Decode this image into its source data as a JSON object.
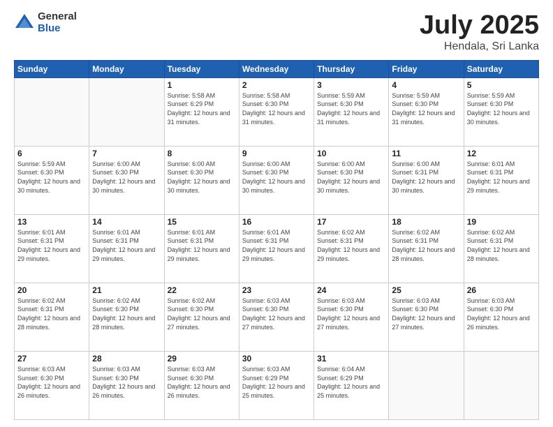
{
  "logo": {
    "general": "General",
    "blue": "Blue"
  },
  "title": {
    "month": "July 2025",
    "location": "Hendala, Sri Lanka"
  },
  "weekdays": [
    "Sunday",
    "Monday",
    "Tuesday",
    "Wednesday",
    "Thursday",
    "Friday",
    "Saturday"
  ],
  "weeks": [
    [
      {
        "day": "",
        "sunrise": "",
        "sunset": "",
        "daylight": ""
      },
      {
        "day": "",
        "sunrise": "",
        "sunset": "",
        "daylight": ""
      },
      {
        "day": "1",
        "sunrise": "Sunrise: 5:58 AM",
        "sunset": "Sunset: 6:29 PM",
        "daylight": "Daylight: 12 hours and 31 minutes."
      },
      {
        "day": "2",
        "sunrise": "Sunrise: 5:58 AM",
        "sunset": "Sunset: 6:30 PM",
        "daylight": "Daylight: 12 hours and 31 minutes."
      },
      {
        "day": "3",
        "sunrise": "Sunrise: 5:59 AM",
        "sunset": "Sunset: 6:30 PM",
        "daylight": "Daylight: 12 hours and 31 minutes."
      },
      {
        "day": "4",
        "sunrise": "Sunrise: 5:59 AM",
        "sunset": "Sunset: 6:30 PM",
        "daylight": "Daylight: 12 hours and 31 minutes."
      },
      {
        "day": "5",
        "sunrise": "Sunrise: 5:59 AM",
        "sunset": "Sunset: 6:30 PM",
        "daylight": "Daylight: 12 hours and 30 minutes."
      }
    ],
    [
      {
        "day": "6",
        "sunrise": "Sunrise: 5:59 AM",
        "sunset": "Sunset: 6:30 PM",
        "daylight": "Daylight: 12 hours and 30 minutes."
      },
      {
        "day": "7",
        "sunrise": "Sunrise: 6:00 AM",
        "sunset": "Sunset: 6:30 PM",
        "daylight": "Daylight: 12 hours and 30 minutes."
      },
      {
        "day": "8",
        "sunrise": "Sunrise: 6:00 AM",
        "sunset": "Sunset: 6:30 PM",
        "daylight": "Daylight: 12 hours and 30 minutes."
      },
      {
        "day": "9",
        "sunrise": "Sunrise: 6:00 AM",
        "sunset": "Sunset: 6:30 PM",
        "daylight": "Daylight: 12 hours and 30 minutes."
      },
      {
        "day": "10",
        "sunrise": "Sunrise: 6:00 AM",
        "sunset": "Sunset: 6:30 PM",
        "daylight": "Daylight: 12 hours and 30 minutes."
      },
      {
        "day": "11",
        "sunrise": "Sunrise: 6:00 AM",
        "sunset": "Sunset: 6:31 PM",
        "daylight": "Daylight: 12 hours and 30 minutes."
      },
      {
        "day": "12",
        "sunrise": "Sunrise: 6:01 AM",
        "sunset": "Sunset: 6:31 PM",
        "daylight": "Daylight: 12 hours and 29 minutes."
      }
    ],
    [
      {
        "day": "13",
        "sunrise": "Sunrise: 6:01 AM",
        "sunset": "Sunset: 6:31 PM",
        "daylight": "Daylight: 12 hours and 29 minutes."
      },
      {
        "day": "14",
        "sunrise": "Sunrise: 6:01 AM",
        "sunset": "Sunset: 6:31 PM",
        "daylight": "Daylight: 12 hours and 29 minutes."
      },
      {
        "day": "15",
        "sunrise": "Sunrise: 6:01 AM",
        "sunset": "Sunset: 6:31 PM",
        "daylight": "Daylight: 12 hours and 29 minutes."
      },
      {
        "day": "16",
        "sunrise": "Sunrise: 6:01 AM",
        "sunset": "Sunset: 6:31 PM",
        "daylight": "Daylight: 12 hours and 29 minutes."
      },
      {
        "day": "17",
        "sunrise": "Sunrise: 6:02 AM",
        "sunset": "Sunset: 6:31 PM",
        "daylight": "Daylight: 12 hours and 29 minutes."
      },
      {
        "day": "18",
        "sunrise": "Sunrise: 6:02 AM",
        "sunset": "Sunset: 6:31 PM",
        "daylight": "Daylight: 12 hours and 28 minutes."
      },
      {
        "day": "19",
        "sunrise": "Sunrise: 6:02 AM",
        "sunset": "Sunset: 6:31 PM",
        "daylight": "Daylight: 12 hours and 28 minutes."
      }
    ],
    [
      {
        "day": "20",
        "sunrise": "Sunrise: 6:02 AM",
        "sunset": "Sunset: 6:31 PM",
        "daylight": "Daylight: 12 hours and 28 minutes."
      },
      {
        "day": "21",
        "sunrise": "Sunrise: 6:02 AM",
        "sunset": "Sunset: 6:30 PM",
        "daylight": "Daylight: 12 hours and 28 minutes."
      },
      {
        "day": "22",
        "sunrise": "Sunrise: 6:02 AM",
        "sunset": "Sunset: 6:30 PM",
        "daylight": "Daylight: 12 hours and 27 minutes."
      },
      {
        "day": "23",
        "sunrise": "Sunrise: 6:03 AM",
        "sunset": "Sunset: 6:30 PM",
        "daylight": "Daylight: 12 hours and 27 minutes."
      },
      {
        "day": "24",
        "sunrise": "Sunrise: 6:03 AM",
        "sunset": "Sunset: 6:30 PM",
        "daylight": "Daylight: 12 hours and 27 minutes."
      },
      {
        "day": "25",
        "sunrise": "Sunrise: 6:03 AM",
        "sunset": "Sunset: 6:30 PM",
        "daylight": "Daylight: 12 hours and 27 minutes."
      },
      {
        "day": "26",
        "sunrise": "Sunrise: 6:03 AM",
        "sunset": "Sunset: 6:30 PM",
        "daylight": "Daylight: 12 hours and 26 minutes."
      }
    ],
    [
      {
        "day": "27",
        "sunrise": "Sunrise: 6:03 AM",
        "sunset": "Sunset: 6:30 PM",
        "daylight": "Daylight: 12 hours and 26 minutes."
      },
      {
        "day": "28",
        "sunrise": "Sunrise: 6:03 AM",
        "sunset": "Sunset: 6:30 PM",
        "daylight": "Daylight: 12 hours and 26 minutes."
      },
      {
        "day": "29",
        "sunrise": "Sunrise: 6:03 AM",
        "sunset": "Sunset: 6:30 PM",
        "daylight": "Daylight: 12 hours and 26 minutes."
      },
      {
        "day": "30",
        "sunrise": "Sunrise: 6:03 AM",
        "sunset": "Sunset: 6:29 PM",
        "daylight": "Daylight: 12 hours and 25 minutes."
      },
      {
        "day": "31",
        "sunrise": "Sunrise: 6:04 AM",
        "sunset": "Sunset: 6:29 PM",
        "daylight": "Daylight: 12 hours and 25 minutes."
      },
      {
        "day": "",
        "sunrise": "",
        "sunset": "",
        "daylight": ""
      },
      {
        "day": "",
        "sunrise": "",
        "sunset": "",
        "daylight": ""
      }
    ]
  ]
}
